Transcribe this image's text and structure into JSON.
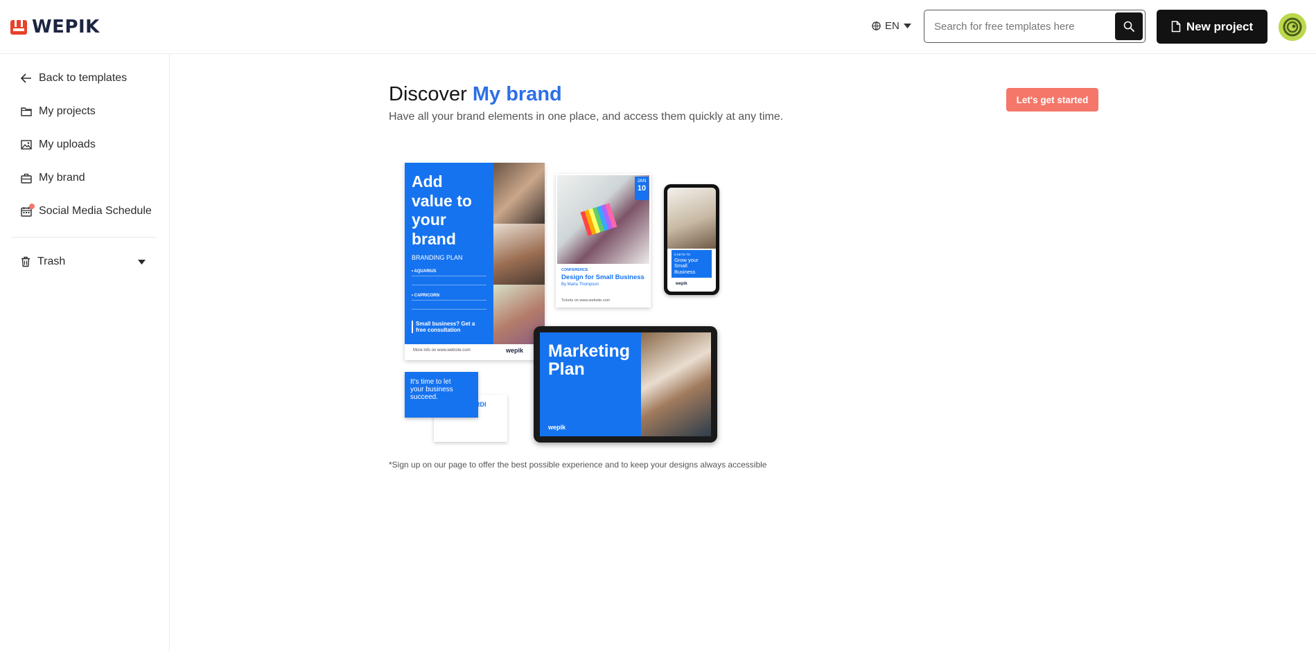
{
  "header": {
    "logo_text": "WEPIK",
    "language": "EN",
    "search": {
      "placeholder": "Search for free templates here"
    },
    "new_project_label": "New project"
  },
  "sidebar": {
    "items": [
      {
        "label": "Back to templates",
        "icon": "arrow-left-icon"
      },
      {
        "label": "My projects",
        "icon": "folder-icon"
      },
      {
        "label": "My uploads",
        "icon": "image-icon"
      },
      {
        "label": "My brand",
        "icon": "briefcase-icon"
      },
      {
        "label": "Social Media Schedule",
        "icon": "calendar-icon"
      }
    ],
    "trash_label": "Trash"
  },
  "main": {
    "title_prefix": "Discover",
    "title_highlight": "My brand",
    "subtitle": "Have all your brand elements in one place, and access them quickly at any time.",
    "cta_label": "Let's get started",
    "footnote": "*Sign up on our page to offer the best possible experience and to keep your designs always accessible"
  },
  "illustration": {
    "poster_title": "Add value to your brand",
    "poster_sub": "BRANDING PLAN",
    "poster_item1": "• AQUARIUS",
    "poster_item2": "• CAPRICORN",
    "poster_cta": "Small business? Get a free consultation",
    "poster_footer": "More info on www.website.com",
    "flyer_tag": "CONFERENCE",
    "flyer_title": "Design for Small Business",
    "flyer_author": "By Marta Thompson",
    "flyer_date_month": "JAN",
    "flyer_date_day": "10",
    "flyer_footer": "Tickets on www.website.com",
    "phone_tag": "5 KEYS TO",
    "phone_title": "Grow your Small Business",
    "card_text": "It's time to let your business succeed.",
    "bizcard_name": "RDI",
    "tablet_title": "Marketing Plan",
    "wepik_small": "wepik"
  },
  "colors": {
    "brand_blue": "#2d6fe6",
    "cta": "#f4776a",
    "logo_red": "#e8412c",
    "dark": "#121212"
  }
}
